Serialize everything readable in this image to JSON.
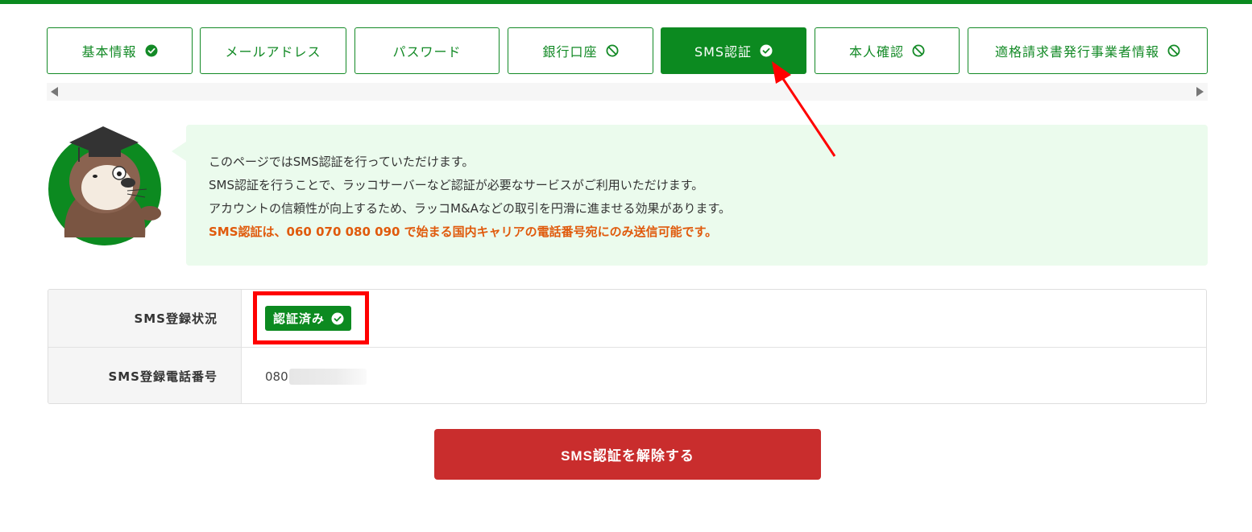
{
  "colors": {
    "brand_green": "#0c8a20",
    "bubble_bg": "#ebfbed",
    "danger": "#c92d2d",
    "warn_text": "#e05a0c",
    "annotation_red": "#ff0000"
  },
  "tabs": [
    {
      "label": "基本情報",
      "icon": "check-circle-icon",
      "active": false
    },
    {
      "label": "メールアドレス",
      "icon": "",
      "active": false
    },
    {
      "label": "パスワード",
      "icon": "",
      "active": false
    },
    {
      "label": "銀行口座",
      "icon": "prohibited-icon",
      "active": false
    },
    {
      "label": "SMS認証",
      "icon": "check-circle-icon",
      "active": true
    },
    {
      "label": "本人確認",
      "icon": "prohibited-icon",
      "active": false
    },
    {
      "label": "適格請求書発行事業者情報",
      "icon": "prohibited-icon",
      "active": false
    }
  ],
  "info": {
    "line1": "このページではSMS認証を行っていただけます。",
    "line2": "SMS認証を行うことで、ラッコサーバーなど認証が必要なサービスがご利用いただけます。",
    "line3": "アカウントの信頼性が向上するため、ラッコM&Aなどの取引を円滑に進ませる効果があります。",
    "warning": "SMS認証は、060 070 080 090 で始まる国内キャリアの電話番号宛にのみ送信可能です。"
  },
  "table": {
    "status_label": "SMS登録状況",
    "status_badge": "認証済み",
    "phone_label": "SMS登録電話番号",
    "phone_value": "080"
  },
  "actions": {
    "release_label": "SMS認証を解除する"
  }
}
